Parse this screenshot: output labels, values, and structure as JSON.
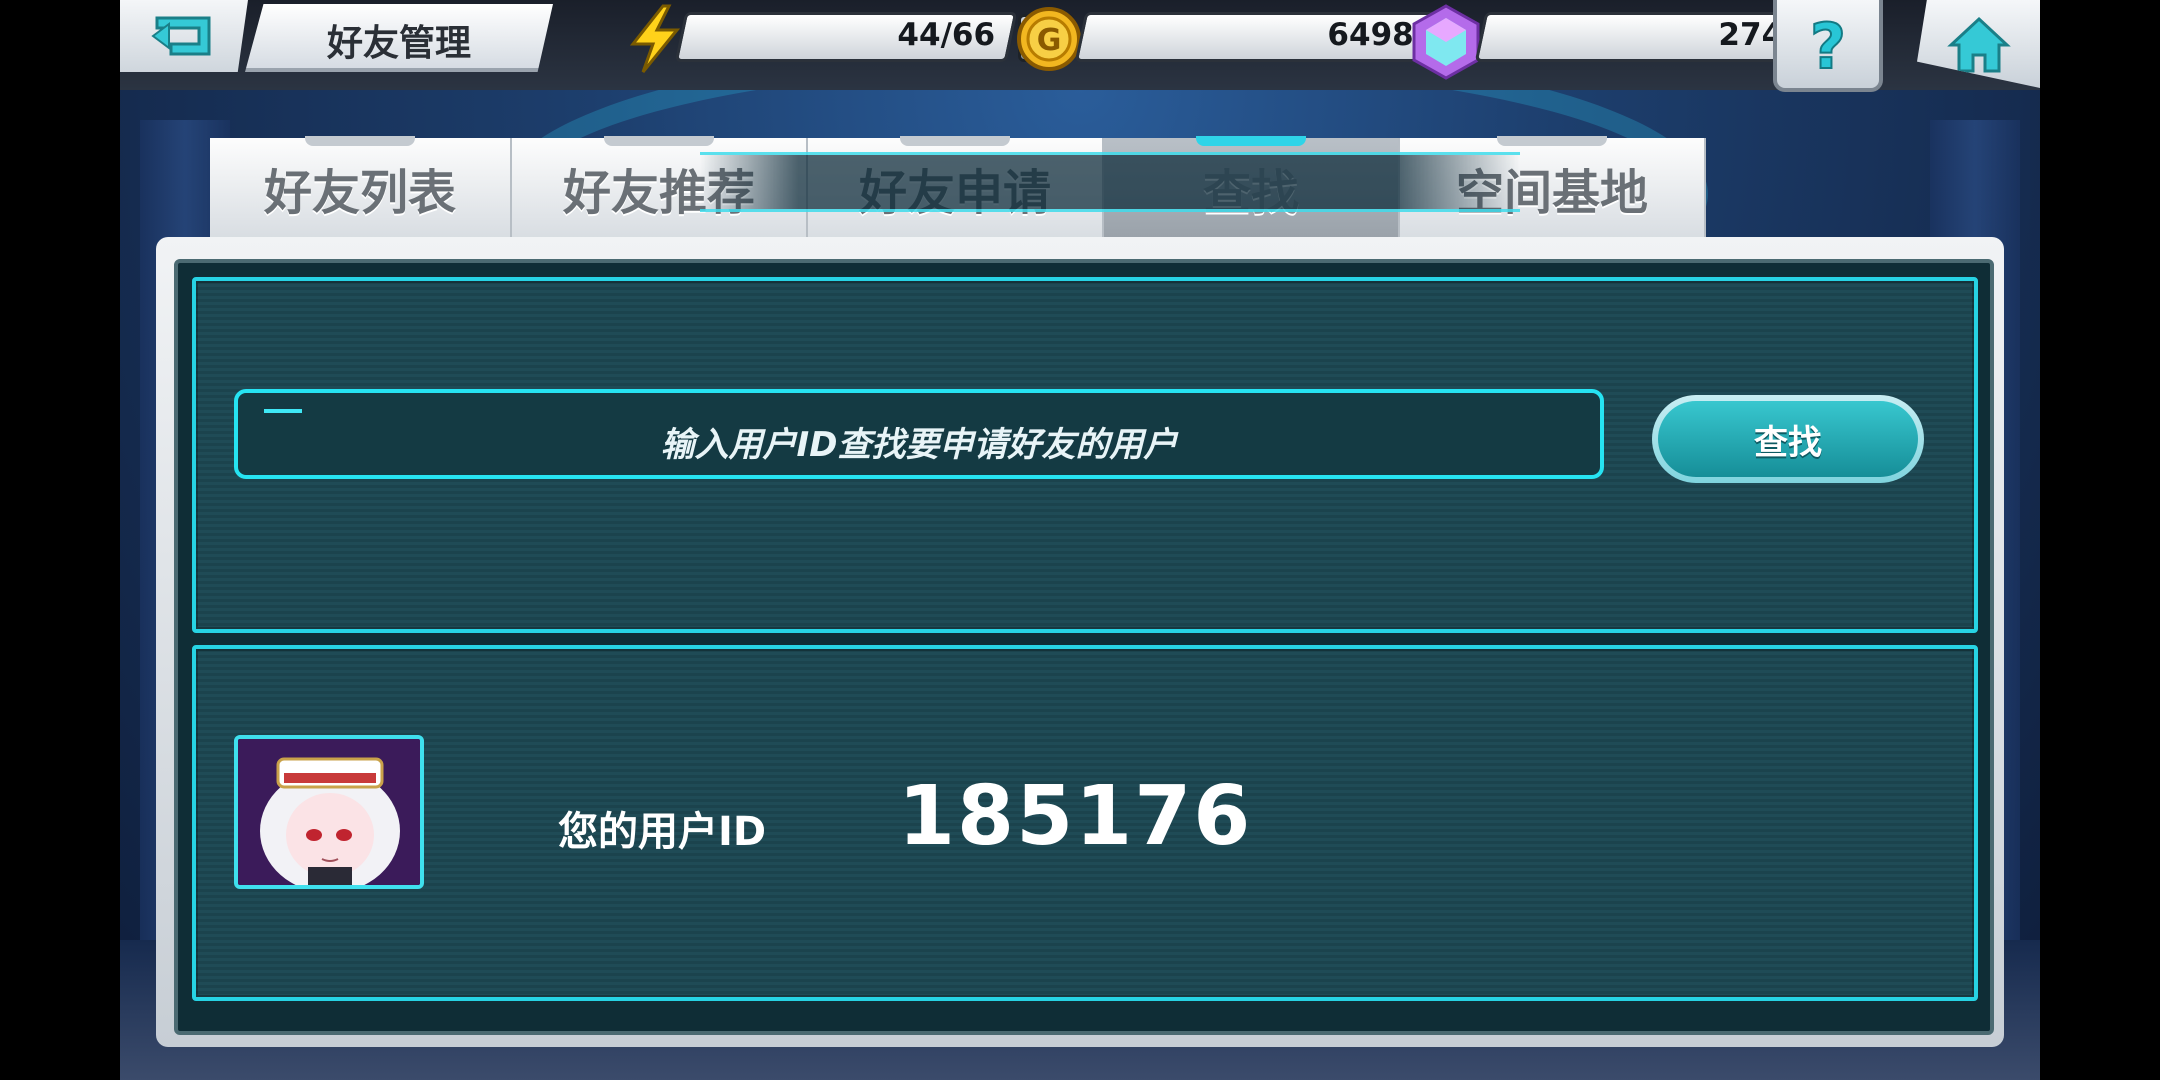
{
  "header": {
    "title": "好友管理",
    "energy": "44/66",
    "gold": "64980",
    "gems": "274",
    "icons": [
      "back-icon",
      "lightning-icon",
      "gold-coin-icon",
      "gem-icon",
      "plus-icon",
      "help-icon",
      "home-icon"
    ]
  },
  "tabs": [
    {
      "label": "好友列表",
      "active": false
    },
    {
      "label": "好友推荐",
      "active": false
    },
    {
      "label": "好友申请",
      "active": false
    },
    {
      "label": "查找",
      "active": true
    },
    {
      "label": "空间基地",
      "active": false
    }
  ],
  "search": {
    "placeholder": "输入用户ID查找要申请好友的用户",
    "button_label": "查找"
  },
  "profile": {
    "id_label": "您的用户ID",
    "user_id": "185176"
  },
  "colors": {
    "accent": "#26e3f2",
    "panel": "#1f4b56",
    "plus": "#8be520"
  }
}
